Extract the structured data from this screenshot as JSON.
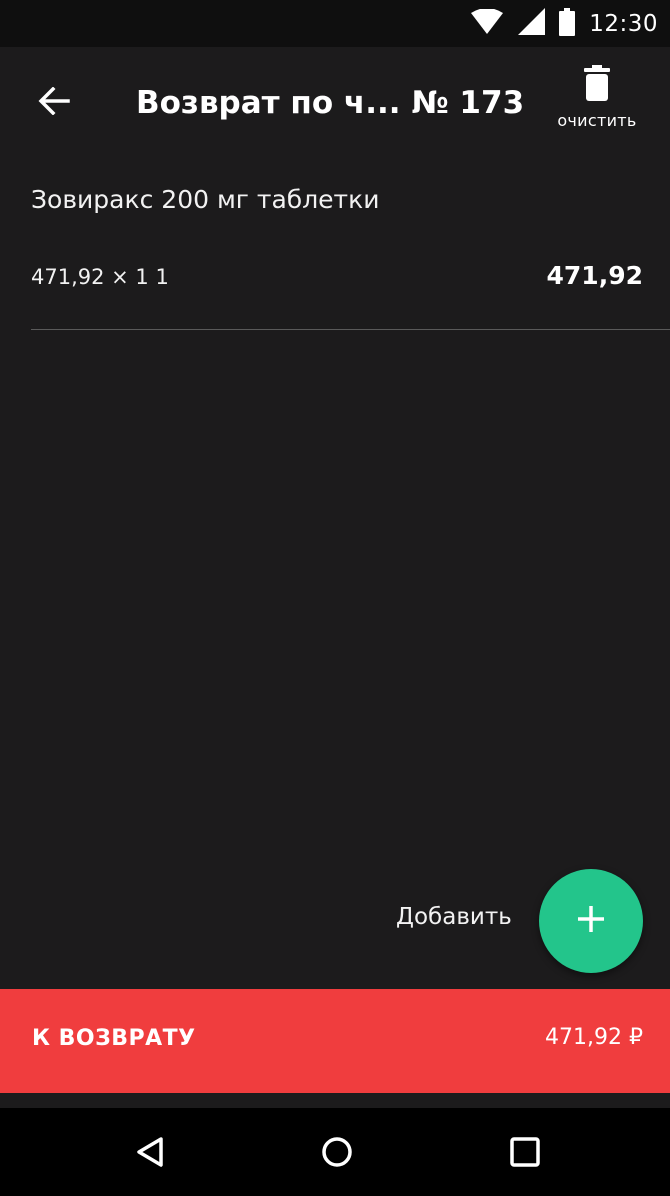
{
  "status_bar": {
    "time": "12:30",
    "icons": [
      "wifi-icon",
      "signal-icon",
      "battery-icon"
    ]
  },
  "app_bar": {
    "title": "Возврат по ч... № 173",
    "clear_label": "очистить",
    "icons": [
      "back-arrow-icon",
      "trash-icon"
    ]
  },
  "items": [
    {
      "name": "Зовиракс 200 мг таблетки",
      "qty_line": "471,92 × 1 1",
      "total": "471,92"
    }
  ],
  "add_action": {
    "label": "Добавить",
    "icon": "plus-icon"
  },
  "return_bar": {
    "label": "К ВОЗВРАТУ",
    "amount": "471,92 ₽"
  },
  "nav_bar": {
    "icons": [
      "back-triangle-icon",
      "home-circle-icon",
      "recents-square-icon"
    ]
  },
  "colors": {
    "background": "#1c1b1c",
    "accent_green": "#23c58b",
    "return_red": "#f03d3e"
  }
}
